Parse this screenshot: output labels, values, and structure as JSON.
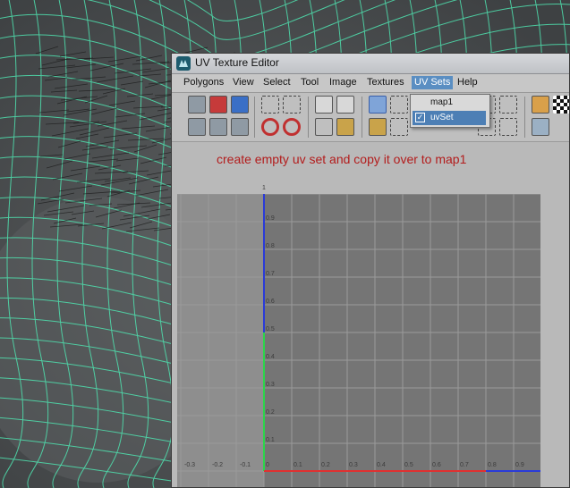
{
  "window": {
    "title": "UV Texture Editor"
  },
  "menus": [
    "Polygons",
    "View",
    "Select",
    "Tool",
    "Image",
    "Textures",
    "UV Sets",
    "Help"
  ],
  "active_menu": "UV Sets",
  "uv_sets_menu": {
    "options": [
      {
        "label": "map1",
        "checked": false
      },
      {
        "label": "uvSet",
        "checked": true
      }
    ]
  },
  "annotation": "create empty uv set and copy it over to map1",
  "uv_grid": {
    "origin_label": "1",
    "v_ticks": [
      "0.9",
      "0.8",
      "0.7",
      "0.6",
      "0.5",
      "0.4",
      "0.3",
      "0.2",
      "0.1"
    ],
    "u_ticks_negative": [
      "-0.3",
      "-0.2",
      "-0.1"
    ],
    "u_ticks_positive": [
      "0",
      "0.1",
      "0.2",
      "0.3",
      "0.4",
      "0.5",
      "0.6",
      "0.7",
      "0.8",
      "0.9"
    ]
  },
  "colors": {
    "annotation": "#b31c1c",
    "wire": "#4fe3b0",
    "axis_u": "#e03030",
    "axis_v": "#2a3bd8",
    "axis_v_green": "#2bd64a",
    "menu_highlight": "#5a8ec2"
  }
}
